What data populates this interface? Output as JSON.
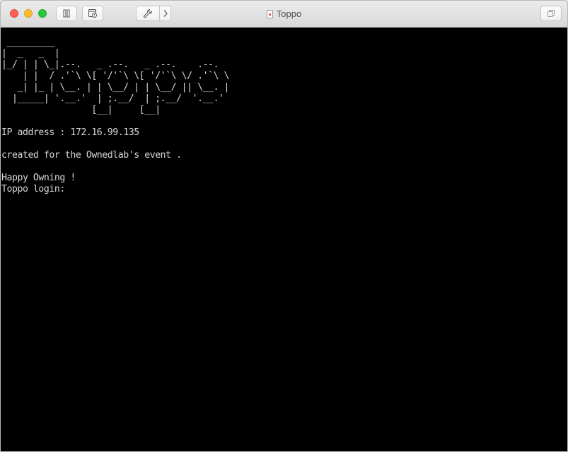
{
  "window": {
    "title": "Toppo"
  },
  "toolbar": {
    "pause_icon": "pause-icon",
    "snapshot_icon": "snapshot-icon",
    "settings_icon": "wrench-icon",
    "settings_more_icon": "chevron-right-icon",
    "restore_icon": "restore-window-icon"
  },
  "terminal": {
    "lines": [
      " _________",
      "|  _   _  |",
      "|_/ | | \\_|.--.   _ .--.   _ .--.    .--.",
      "    | |  / .'`\\ \\[ '/'`\\ \\[ '/'`\\ \\/ .'`\\ \\",
      "   _| |_ | \\__. | | \\__/ | | \\__/ || \\__. |",
      "  |_____| '.__.'  | ;.__/  | ;.__/  '.__.'",
      "                 [__|     [__|",
      "",
      "IP address : 172.16.99.135",
      "",
      "created for the Ownedlab's event .",
      "",
      "Happy Owning !",
      "Toppo login: "
    ]
  }
}
